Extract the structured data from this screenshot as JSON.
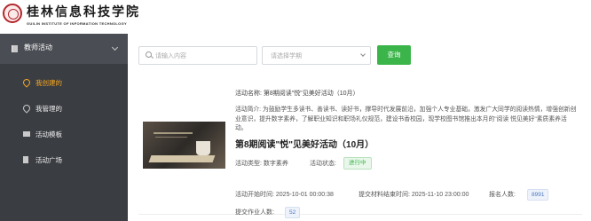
{
  "header": {
    "logo_cn": "桂林信息科技学院",
    "logo_en": "GUILIN INSTITUTE OF INFORMATION TECHNOLOGY"
  },
  "sidebar": {
    "section_label": "教师活动",
    "items": [
      {
        "label": "我创建的",
        "icon": "location-pin-icon",
        "active": true
      },
      {
        "label": "我管理的",
        "icon": "location-pin-icon",
        "active": false
      },
      {
        "label": "活动模板",
        "icon": "template-icon",
        "active": false
      },
      {
        "label": "活动广场",
        "icon": "flag-icon",
        "active": false
      }
    ]
  },
  "toolbar": {
    "search_placeholder": "请输入内容",
    "semester_placeholder": "请选择学期",
    "query_label": "查询"
  },
  "activity": {
    "name_line": "活动名称: 第8期阅读\"悦\"见美好活动（10月）",
    "intro": "活动简介: 为鼓励学生多读书、善读书、读好书，撑导时代发展前沿，加强个人专业基础，激发广大同学的阅读热情，增强创新创业意识，提升数字素养，了解职业知识和职场礼仪规范，建设书香校园，现学校图书馆推出本月的\"阅读 悦见美好\"素质素养活动。",
    "title": "第8期阅读\"悦\"见美好活动（10月）",
    "type_line": "活动类型: 数字素养",
    "status_label": "活动状态:",
    "status": "进行中",
    "start_line": "活动开始时间: 2025-10-01 00:00:38",
    "end_line": "提交材料结束时间: 2025-11-10 23:00:00",
    "enroll_label": "报名人数:",
    "enroll_count": "8991",
    "submit_label": "提交作业人数:",
    "submit_count": "52"
  },
  "colors": {
    "accent_green": "#3bb54a",
    "active_orange": "#f5a623",
    "sidebar_bg": "#3a3d42"
  }
}
